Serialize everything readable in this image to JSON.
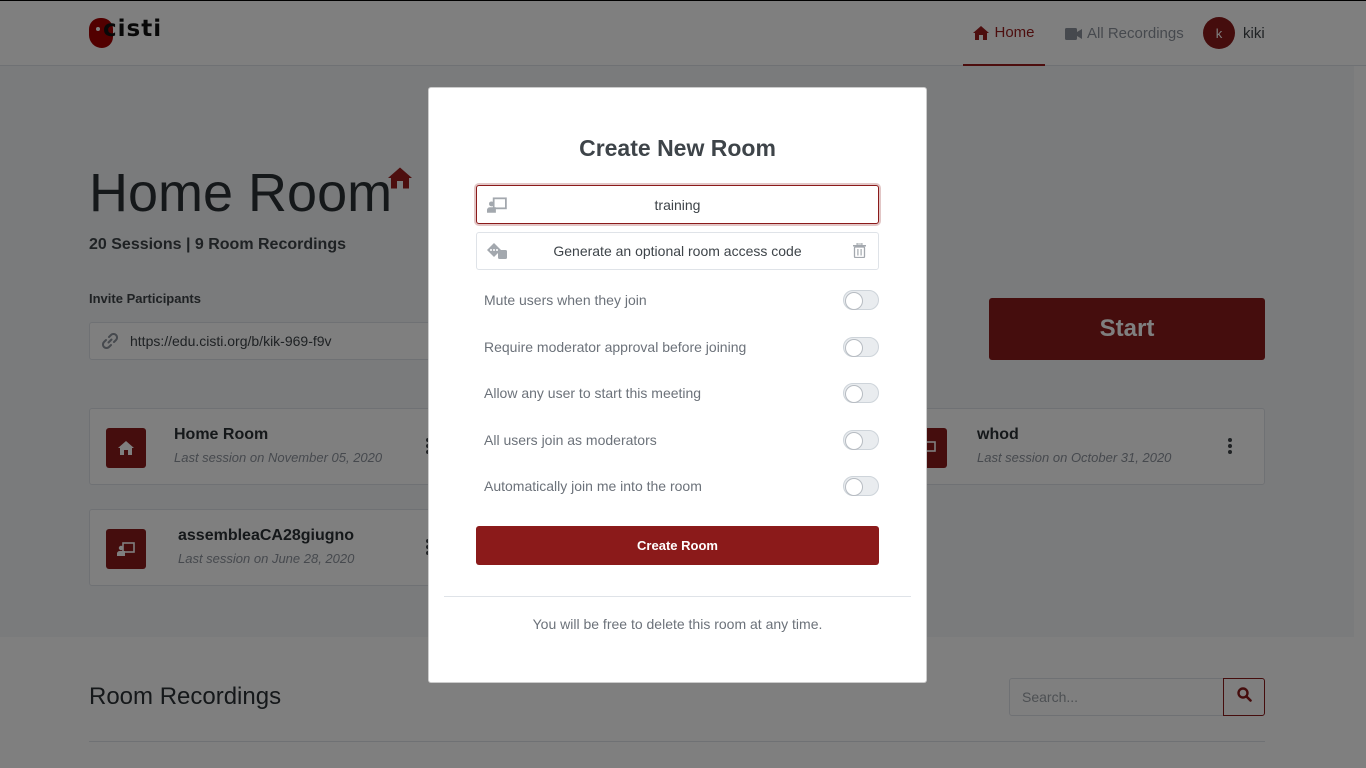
{
  "header": {
    "logo_text": "cisti",
    "nav": [
      {
        "label": "Home",
        "icon": "home-icon",
        "active": true
      },
      {
        "label": "All Recordings",
        "icon": "video-icon",
        "active": false
      }
    ],
    "user": {
      "initial": "k",
      "name": "kiki"
    }
  },
  "room": {
    "title": "Home Room",
    "stats": "20 Sessions | 9 Room Recordings",
    "invite_label": "Invite Participants",
    "invite_url": "https://edu.cisti.org/b/kik-969-f9v",
    "start_label": "Start"
  },
  "rooms": [
    {
      "name": "Home Room",
      "last_session": "Last session on November 05, 2020",
      "icon": "home-icon"
    },
    {
      "name": "whod",
      "last_session": "Last session on October 31, 2020",
      "icon": "chalkboard-teacher-icon"
    },
    {
      "name": "assembleaCA28giugno",
      "last_session": "Last session on June 28, 2020",
      "icon": "chalkboard-teacher-icon"
    }
  ],
  "recordings": {
    "title": "Room Recordings",
    "search_placeholder": "Search..."
  },
  "modal": {
    "title": "Create New Room",
    "name_value": "training",
    "access_code_text": "Generate an optional room access code",
    "options": [
      {
        "label": "Mute users when they join",
        "enabled": false
      },
      {
        "label": "Require moderator approval before joining",
        "enabled": false
      },
      {
        "label": "Allow any user to start this meeting",
        "enabled": false
      },
      {
        "label": "All users join as moderators",
        "enabled": false
      },
      {
        "label": "Automatically join me into the room",
        "enabled": false
      }
    ],
    "create_label": "Create Room",
    "footer": "You will be free to delete this room at any time."
  },
  "colors": {
    "brand": "#8b1a1a",
    "text_dark": "#2b3035",
    "text_muted": "#6c727a"
  }
}
